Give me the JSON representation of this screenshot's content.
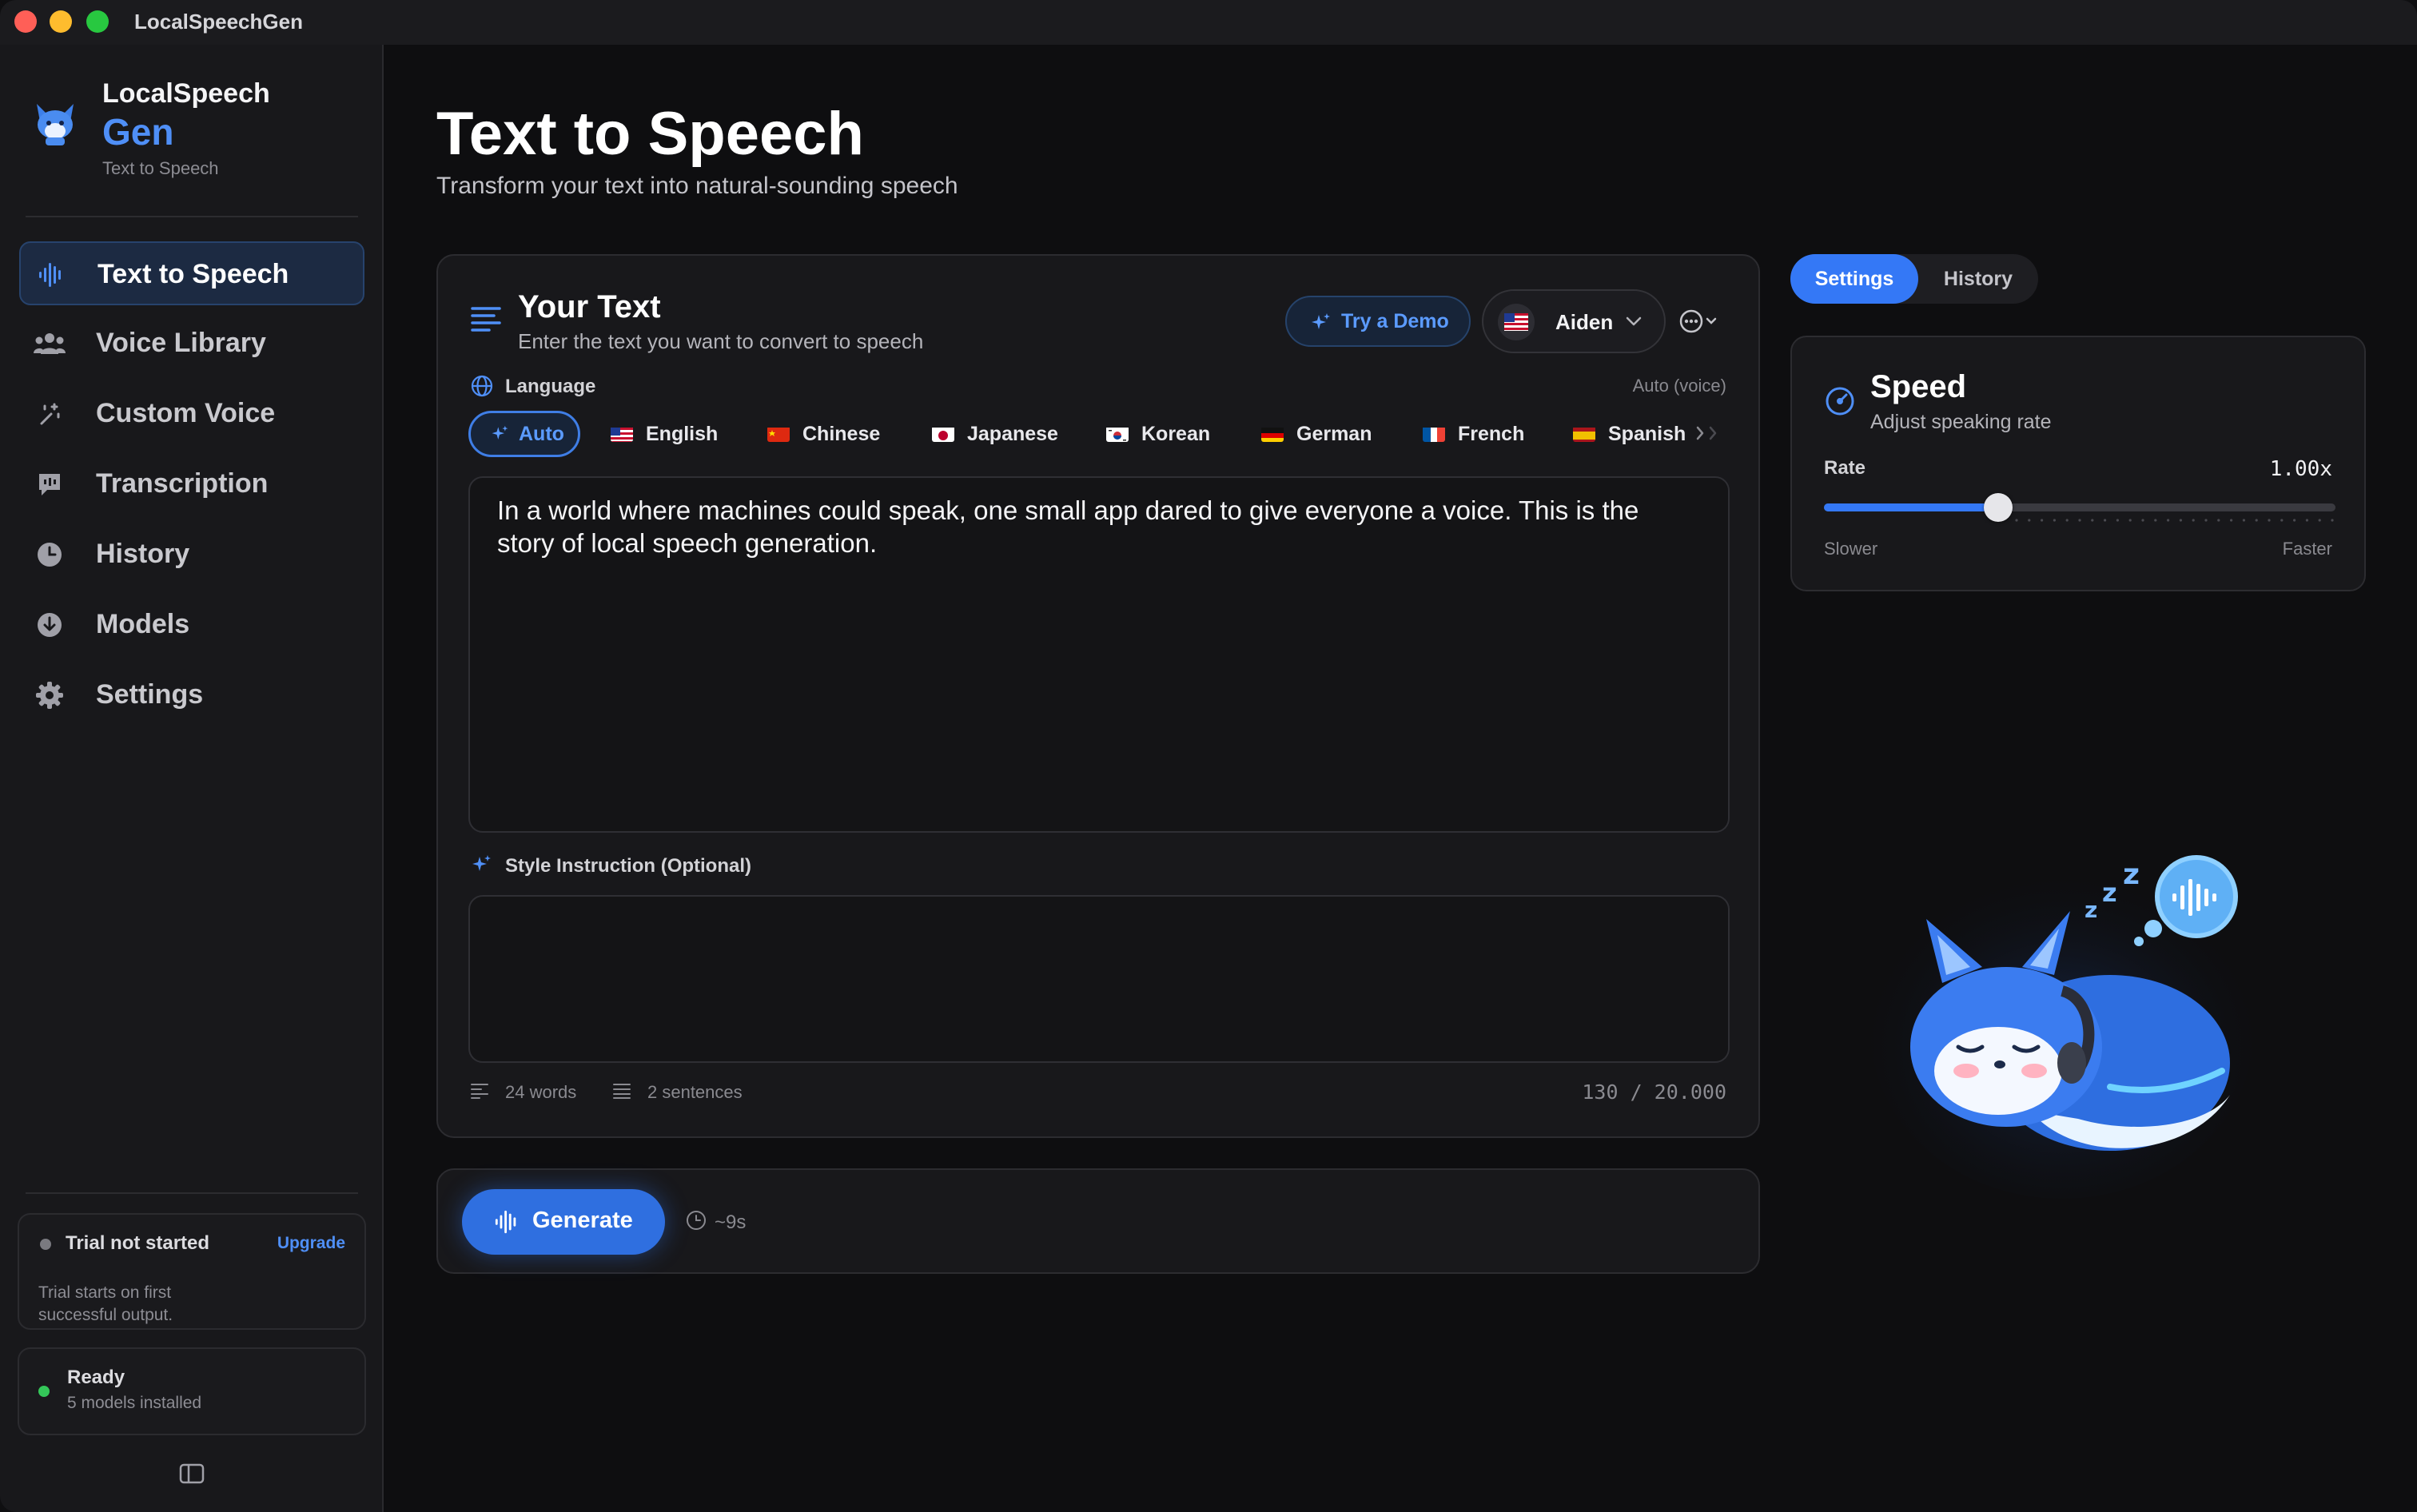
{
  "window": {
    "title": "LocalSpeechGen"
  },
  "sidebar": {
    "brand_line1": "LocalSpeech",
    "brand_line2": "Gen",
    "brand_sub": "Text to Speech",
    "items": [
      {
        "label": "Text to Speech",
        "icon": "waveform-icon",
        "active": true
      },
      {
        "label": "Voice Library",
        "icon": "people-icon",
        "active": false
      },
      {
        "label": "Custom Voice",
        "icon": "magic-wand-icon",
        "active": false
      },
      {
        "label": "Transcription",
        "icon": "speech-bubble-icon",
        "active": false
      },
      {
        "label": "History",
        "icon": "clock-icon",
        "active": false
      },
      {
        "label": "Models",
        "icon": "download-icon",
        "active": false
      },
      {
        "label": "Settings",
        "icon": "gear-icon",
        "active": false
      }
    ],
    "trial": {
      "title": "Trial not started",
      "upgrade": "Upgrade",
      "sub": "Trial starts on first successful output."
    },
    "status": {
      "title": "Ready",
      "sub": "5 models installed"
    }
  },
  "header": {
    "title": "Text to Speech",
    "subtitle": "Transform your text into natural-sounding speech"
  },
  "text_panel": {
    "title": "Your Text",
    "subtitle": "Enter the text you want to convert to speech",
    "demo_button": "Try a Demo",
    "voice": "Aiden",
    "language_label": "Language",
    "language_mode": "Auto (voice)",
    "languages": [
      {
        "label": "Auto",
        "flag": "sparkle",
        "active": true
      },
      {
        "label": "English",
        "flag": "us",
        "active": false
      },
      {
        "label": "Chinese",
        "flag": "cn",
        "active": false
      },
      {
        "label": "Japanese",
        "flag": "jp",
        "active": false
      },
      {
        "label": "Korean",
        "flag": "kr",
        "active": false
      },
      {
        "label": "German",
        "flag": "de",
        "active": false
      },
      {
        "label": "French",
        "flag": "fr",
        "active": false
      },
      {
        "label": "Spanish",
        "flag": "es",
        "active": false
      }
    ],
    "text": "In a world where machines could speak, one small app dared to give everyone a voice. This is the story of local speech generation.",
    "style_label": "Style Instruction (Optional)",
    "style_value": "",
    "words": "24 words",
    "sentences": "2 sentences",
    "char_count": "130 / 20.000"
  },
  "generate": {
    "label": "Generate",
    "eta": "~9s"
  },
  "right": {
    "tabs": [
      {
        "label": "Settings",
        "active": true
      },
      {
        "label": "History",
        "active": false
      }
    ],
    "speed": {
      "title": "Speed",
      "subtitle": "Adjust speaking rate",
      "rate_label": "Rate",
      "rate_value": "1.00x",
      "slider_fraction": 0.34,
      "min_label": "Slower",
      "max_label": "Faster"
    }
  },
  "colors": {
    "accent": "#3478f6",
    "brand_blue": "#4f8ff7",
    "ready_green": "#34c759"
  }
}
